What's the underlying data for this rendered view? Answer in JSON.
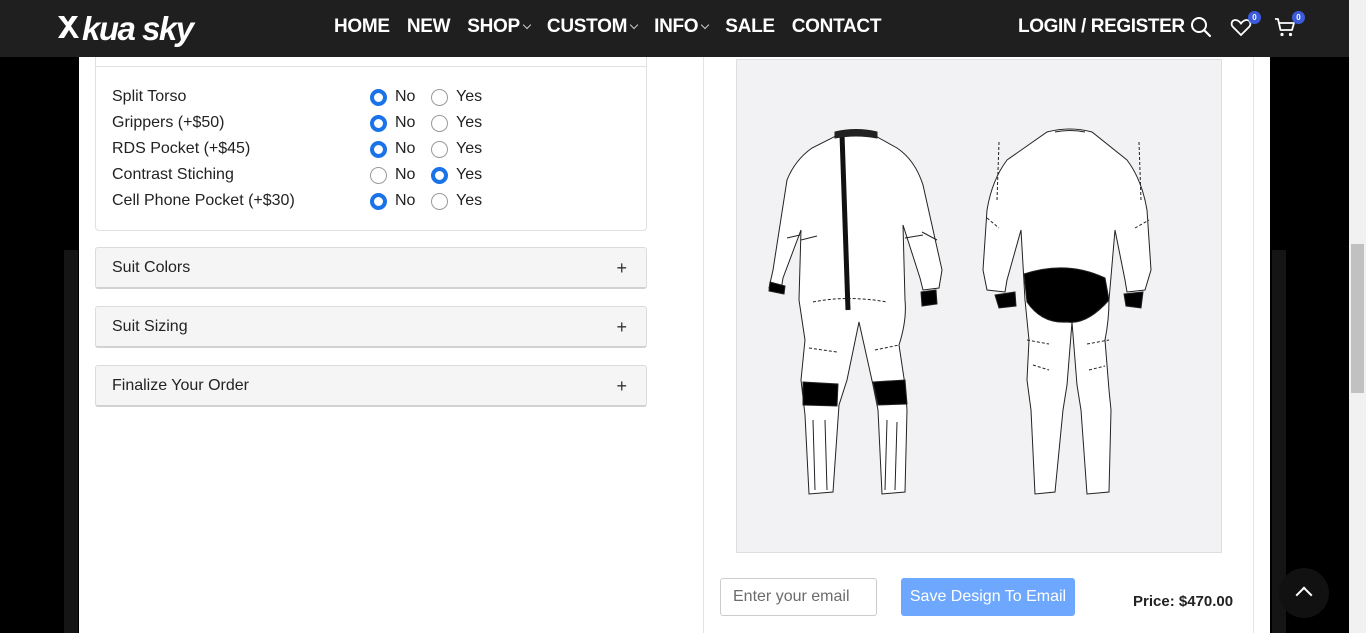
{
  "header": {
    "logo_text": "kua sky",
    "nav": [
      {
        "label": "HOME",
        "has_dropdown": false
      },
      {
        "label": "NEW",
        "has_dropdown": false
      },
      {
        "label": "SHOP",
        "has_dropdown": true
      },
      {
        "label": "CUSTOM",
        "has_dropdown": true
      },
      {
        "label": "INFO",
        "has_dropdown": true
      },
      {
        "label": "SALE",
        "has_dropdown": false
      },
      {
        "label": "CONTACT",
        "has_dropdown": false
      }
    ],
    "login_label": "LOGIN / REGISTER",
    "wishlist_count": "0",
    "cart_count": "0"
  },
  "options": {
    "no_label": "No",
    "yes_label": "Yes",
    "rows": [
      {
        "label": "Split Torso",
        "selected": "No"
      },
      {
        "label": "Grippers (+$50)",
        "selected": "No"
      },
      {
        "label": "RDS Pocket (+$45)",
        "selected": "No"
      },
      {
        "label": "Contrast Stiching",
        "selected": "Yes"
      },
      {
        "label": "Cell Phone Pocket (+$30)",
        "selected": "No"
      }
    ]
  },
  "accordions": [
    {
      "title": "Suit Colors",
      "icon": "plus-icon"
    },
    {
      "title": "Suit Sizing",
      "icon": "plus-icon"
    },
    {
      "title": "Finalize Your Order",
      "icon": "plus-icon"
    }
  ],
  "footer": {
    "email_placeholder": "Enter your email",
    "save_label": "Save Design To Email",
    "price_text": "Price: $470.00"
  },
  "colors": {
    "accent": "#1a73e8",
    "save_button": "#6ea8fe",
    "header_bg": "#1f1f1f"
  }
}
